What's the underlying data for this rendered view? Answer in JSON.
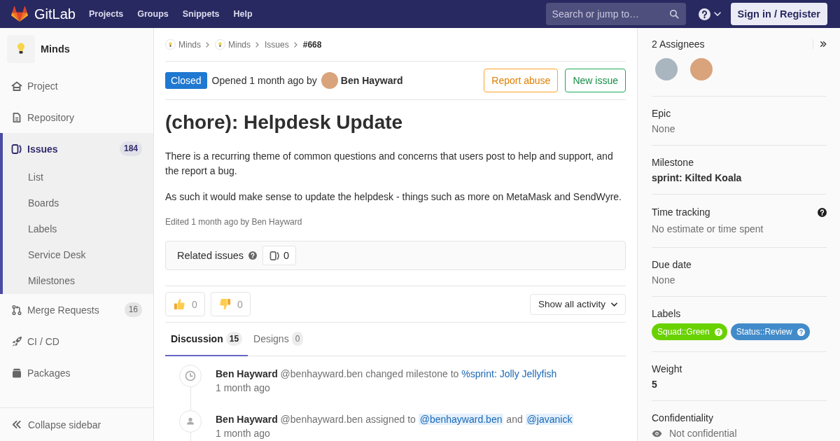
{
  "top_nav": {
    "brand": "GitLab",
    "links": [
      "Projects",
      "Groups",
      "Snippets",
      "Help"
    ],
    "search": {
      "placeholder": "Search or jump to…"
    },
    "sign_in": "Sign in / Register"
  },
  "sidebar": {
    "project": "Minds",
    "items": [
      {
        "label": "Project",
        "selected": false
      },
      {
        "label": "Repository",
        "selected": false
      },
      {
        "label": "Issues",
        "count": "184",
        "selected": true,
        "children": [
          {
            "label": "List",
            "selected": false
          },
          {
            "label": "Boards",
            "selected": false
          },
          {
            "label": "Labels",
            "selected": false
          },
          {
            "label": "Service Desk",
            "selected": false
          },
          {
            "label": "Milestones",
            "selected": false
          }
        ]
      },
      {
        "label": "Merge Requests",
        "count": "16",
        "selected": false
      },
      {
        "label": "CI / CD",
        "selected": false
      },
      {
        "label": "Packages",
        "selected": false
      }
    ],
    "collapse": "Collapse sidebar"
  },
  "breadcrumbs": [
    {
      "label": "Minds",
      "kind": "project"
    },
    {
      "label": "Minds",
      "kind": "project"
    },
    {
      "label": "Issues",
      "kind": "link"
    },
    {
      "label": "#668",
      "kind": "current"
    }
  ],
  "issue": {
    "status": "Closed",
    "opened": "Opened 1 month ago by",
    "author": "Ben Hayward",
    "buttons": [
      {
        "label": "Report abuse",
        "kind": "warning"
      },
      {
        "label": "New issue",
        "kind": "success"
      }
    ],
    "title": "(chore): Helpdesk Update",
    "description": [
      "There is a recurring theme of common questions and concerns that users post to help and support, and the report a bug.",
      "As such it would make sense to update the helpdesk - things such as more on MetaMask and SendWyre."
    ],
    "edited": "Edited 1 month ago by Ben Hayward"
  },
  "related_issues": {
    "title": "Related issues",
    "count": "0"
  },
  "awards": [
    {
      "kind": "thumbsup",
      "count": "0"
    },
    {
      "kind": "thumbsdown",
      "count": "0"
    }
  ],
  "activity_filter": "Show all activity",
  "tabs": [
    {
      "label": "Discussion",
      "count": "15",
      "selected": true
    },
    {
      "label": "Designs",
      "count": "0",
      "selected": false
    }
  ],
  "notes": [
    {
      "kind": "milestone",
      "author": "Ben Hayward",
      "parts": [
        {
          "kind": "text",
          "text": "@benhayward.ben changed milestone to"
        },
        {
          "kind": "link",
          "text": "%sprint: Jolly Jellyfish"
        }
      ],
      "time": "1 month ago"
    },
    {
      "kind": "assignee",
      "author": "Ben Hayward",
      "parts": [
        {
          "kind": "text",
          "text": "@benhayward.ben assigned to"
        },
        {
          "kind": "mention",
          "text": "@benhayward.ben"
        },
        {
          "kind": "text",
          "text": "and"
        },
        {
          "kind": "mention",
          "text": "@javanick"
        }
      ],
      "time": "1 month ago"
    }
  ],
  "right_sidebar": {
    "assignees": {
      "title": "2 Assignees",
      "avatars": [
        {
          "color": "#a9b6c0"
        },
        {
          "color": "#d9a37c"
        }
      ]
    },
    "sections": [
      {
        "kind": "plain",
        "title": "Epic",
        "value": "None"
      },
      {
        "kind": "strong",
        "title": "Milestone",
        "value": "sprint: Kilted Koala"
      },
      {
        "kind": "timetracking",
        "title": "Time tracking",
        "value": "No estimate or time spent"
      },
      {
        "kind": "plain",
        "title": "Due date",
        "value": "None"
      },
      {
        "kind": "labels",
        "title": "Labels",
        "labels": [
          {
            "text": "Squad::Green",
            "color": "#69d100"
          },
          {
            "text": "Status::Review",
            "color": "#428bca"
          }
        ]
      },
      {
        "kind": "strong",
        "title": "Weight",
        "value": "5"
      },
      {
        "kind": "confidential",
        "title": "Confidentiality",
        "value": "Not confidential"
      }
    ]
  }
}
